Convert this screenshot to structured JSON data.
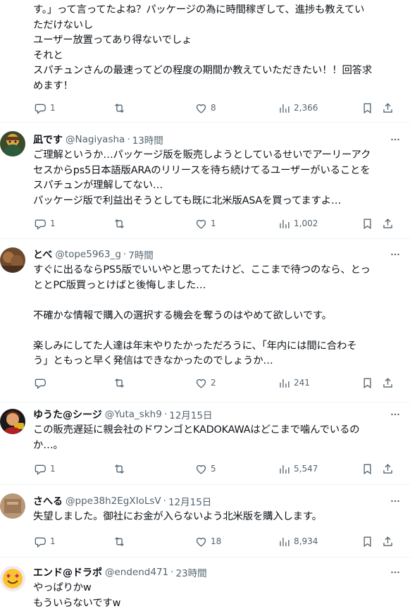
{
  "tweets": [
    {
      "body_lines": [
        "す。」って言ってたよね？パッケージの為に時間稼ぎして、進捗も教えてい",
        "ただけないし",
        "ユーザー放置ってあり得ないでしょ",
        "それと",
        "スパチュンさんの最速ってどの程度の期間か教えていただきたい！！回答求",
        "めます！"
      ],
      "replies": "1",
      "retweets": "",
      "likes": "8",
      "views": "2,366"
    },
    {
      "name": "凪です",
      "handle": "@Nagiyasha",
      "time": "13時間",
      "body_lines": [
        "ご理解というか…パッケージ版を販売しようとしているせいでアーリーアク",
        "セスからps5日本語版ARAのリリースを待ち続けてるユーザーがいることを",
        "スパチュンが理解してない…",
        "パッケージ版で利益出そうとしても既に北米版ASAを買ってますよ…"
      ],
      "replies": "1",
      "retweets": "",
      "likes": "1",
      "views": "1,002"
    },
    {
      "name": "とべ",
      "handle": "@tope5963_g",
      "time": "7時間",
      "body_lines": [
        "すぐに出るならPS5版でいいやと思ってたけど、ここまで待つのなら、とっ",
        "ととPC版買っとけばと後悔しました…",
        "",
        "不確かな情報で購入の選択する機会を奪うのはやめて欲しいです。",
        "",
        "楽しみにしてた人達は年末やりたかっただろうに、「年内には間に合わそ",
        "う」ともっと早く発信はできなかったのでしょうか…"
      ],
      "replies": "",
      "retweets": "",
      "likes": "2",
      "views": "241"
    },
    {
      "name": "ゆうた@シージ",
      "handle": "@Yuta_skh9",
      "time": "12月15日",
      "body_lines": [
        "この販売遅延に親会社のドワンゴとKADOKAWAはどこまで噛んでいるの",
        "か…。"
      ],
      "replies": "1",
      "retweets": "",
      "likes": "5",
      "views": "5,547"
    },
    {
      "name": "さへる",
      "handle": "@ppe38h2EgXIoLsV",
      "time": "12月15日",
      "body_lines": [
        "失望しました。御社にお金が入らないよう北米版を購入します。"
      ],
      "replies": "1",
      "retweets": "",
      "likes": "18",
      "views": "8,934"
    },
    {
      "name": "エンド@ドラポ",
      "handle": "@endend471",
      "time": "23時間",
      "body_lines": [
        "やっぱりかw",
        "もういらないですw"
      ]
    }
  ],
  "separator": "·",
  "icons": {
    "reply": "reply-icon",
    "retweet": "retweet-icon",
    "like": "heart-icon",
    "views": "views-icon",
    "bookmark": "bookmark-icon",
    "share": "share-icon",
    "more": "more-icon"
  }
}
